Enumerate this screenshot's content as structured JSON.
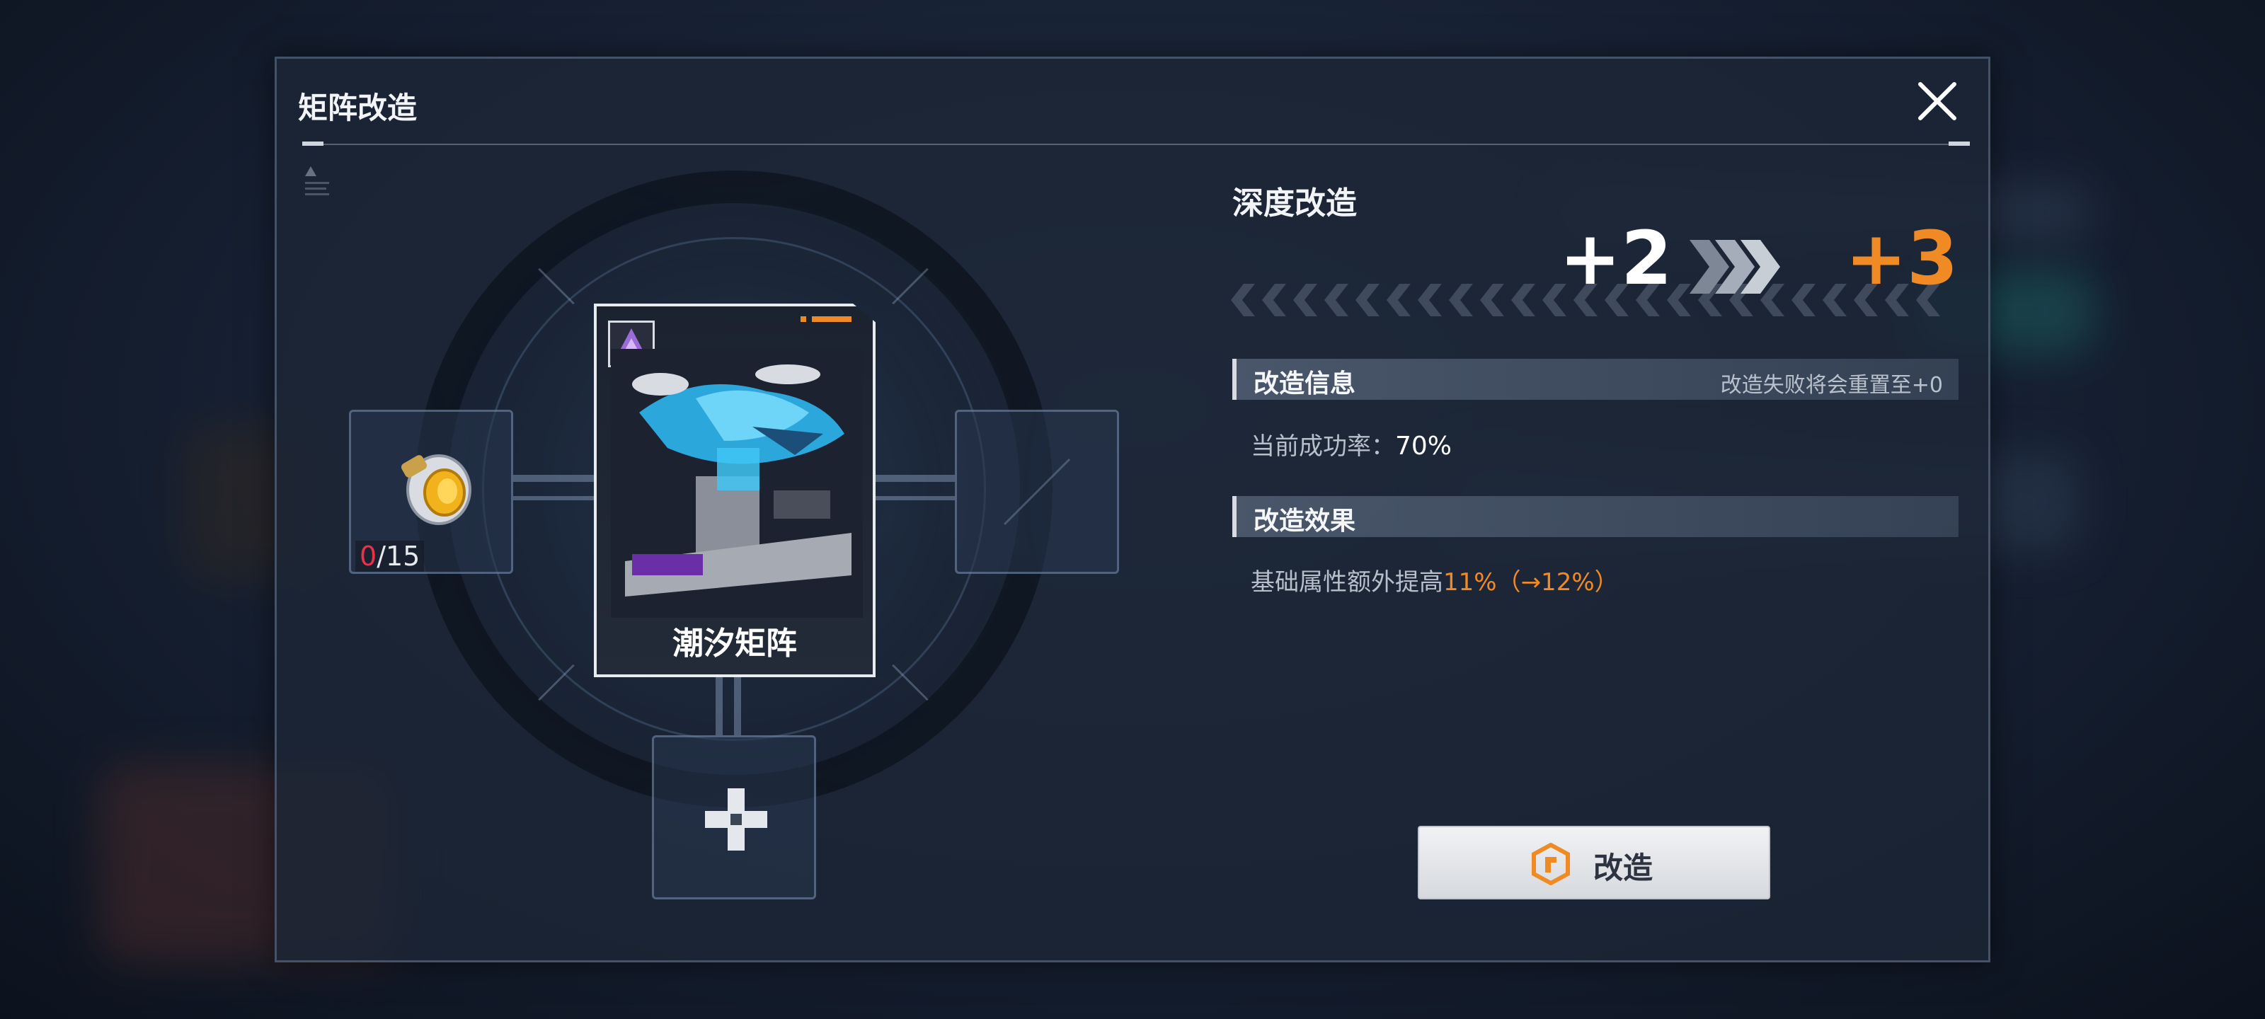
{
  "dialog": {
    "title": "矩阵改造",
    "close_icon": "close-icon"
  },
  "slots": {
    "material_count_current": "0",
    "material_count_sep": "/",
    "material_count_total": "15",
    "material_icon": "gold-coin-capsule-icon",
    "add_icon": "plus-icon"
  },
  "card": {
    "name": "潮汐矩阵",
    "badge_icon": "purple-rank-icon",
    "art": "mechanical-shark-fortress-art"
  },
  "upgrade": {
    "section_title": "深度改造",
    "level_from": "+2",
    "level_to": "+3",
    "arrow_icon": "triple-chevron-right-icon"
  },
  "info": {
    "label": "改造信息",
    "note": "改造失败将会重置至+0",
    "rate_label": "当前成功率：",
    "rate_value": "70%"
  },
  "effect": {
    "label": "改造效果",
    "text_prefix": "基础属性额外提高",
    "text_value": "11%（→12%）"
  },
  "button": {
    "label": "改造",
    "icon": "wrench-hexagon-icon"
  },
  "colors": {
    "accent": "#f08a24",
    "count_current": "#e8324a",
    "panel": "#1c2636"
  }
}
